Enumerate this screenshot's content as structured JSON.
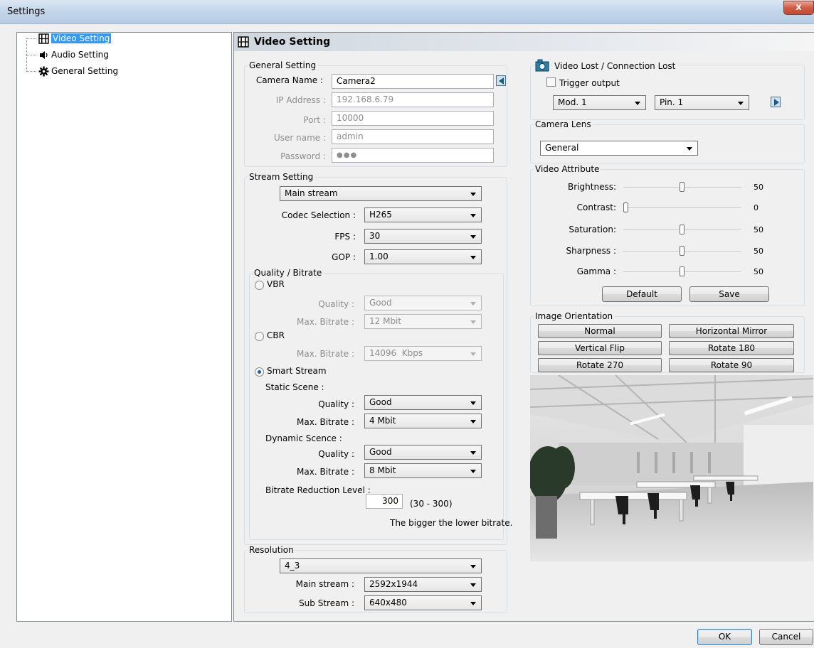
{
  "window": {
    "title": "Settings",
    "close_symbol": "x"
  },
  "tree": {
    "items": [
      {
        "label": "Video Setting",
        "icon": "film-icon",
        "selected": true
      },
      {
        "label": "Audio Setting",
        "icon": "speaker-icon",
        "selected": false
      },
      {
        "label": "General Setting",
        "icon": "gear-icon",
        "selected": false
      }
    ]
  },
  "header": {
    "title": "Video Setting",
    "icon": "film-icon"
  },
  "general": {
    "legend": "General Setting",
    "camera_name_label": "Camera Name :",
    "camera_name": "Camera2",
    "ip_label": "IP Address :",
    "ip": "192.168.6.79",
    "port_label": "Port :",
    "port": "10000",
    "user_label": "User name :",
    "user": "admin",
    "password_label": "Password :",
    "password": "●●●"
  },
  "stream": {
    "legend": "Stream Setting",
    "stream_select": "Main stream",
    "codec_label": "Codec Selection :",
    "codec": "H265",
    "fps_label": "FPS :",
    "fps": "30",
    "gop_label": "GOP :",
    "gop": "1.00",
    "quality_legend": "Quality / Bitrate",
    "vbr_label": "VBR",
    "vbr_quality_label": "Quality :",
    "vbr_quality": "Good",
    "vbr_max_label": "Max. Bitrate :",
    "vbr_max": "12 Mbit",
    "cbr_label": "CBR",
    "cbr_max_label": "Max. Bitrate :",
    "cbr_max": "14096  Kbps",
    "smart_label": "Smart Stream",
    "static_label": "Static Scene :",
    "static_quality_label": "Quality :",
    "static_quality": "Good",
    "static_max_label": "Max. Bitrate :",
    "static_max": "4 Mbit",
    "dynamic_label": "Dynamic Scence :",
    "dynamic_quality_label": "Quality :",
    "dynamic_quality": "Good",
    "dynamic_max_label": "Max. Bitrate :",
    "dynamic_max": "8 Mbit",
    "reduction_label": "Bitrate Reduction Level :",
    "reduction_value": "300",
    "reduction_range": "(30 - 300)",
    "reduction_hint": "The bigger the lower bitrate.",
    "selected_mode": "Smart Stream"
  },
  "resolution": {
    "legend": "Resolution",
    "aspect": "4_3",
    "main_label": "Main stream :",
    "main": "2592x1944",
    "sub_label": "Sub Stream :",
    "sub": "640x480"
  },
  "video_lost": {
    "legend": "Video Lost / Connection Lost",
    "trigger_label": "Trigger output",
    "trigger_checked": false,
    "mod": "Mod. 1",
    "pin": "Pin. 1"
  },
  "lens": {
    "legend": "Camera Lens",
    "value": "General"
  },
  "attributes": {
    "legend": "Video Attribute",
    "brightness_label": "Brightness:",
    "brightness": 50,
    "contrast_label": "Contrast:",
    "contrast": 0,
    "saturation_label": "Saturation:",
    "saturation": 50,
    "sharpness_label": "Sharpness :",
    "sharpness": 50,
    "gamma_label": "Gamma :",
    "gamma": 50,
    "default_label": "Default",
    "save_label": "Save"
  },
  "orientation": {
    "legend": "Image Orientation",
    "normal": "Normal",
    "hmirror": "Horizontal Mirror",
    "vflip": "Vertical Flip",
    "rot180": "Rotate 180",
    "rot270": "Rotate 270",
    "rot90": "Rotate 90"
  },
  "footer": {
    "ok_label": "OK",
    "cancel_label": "Cancel"
  }
}
